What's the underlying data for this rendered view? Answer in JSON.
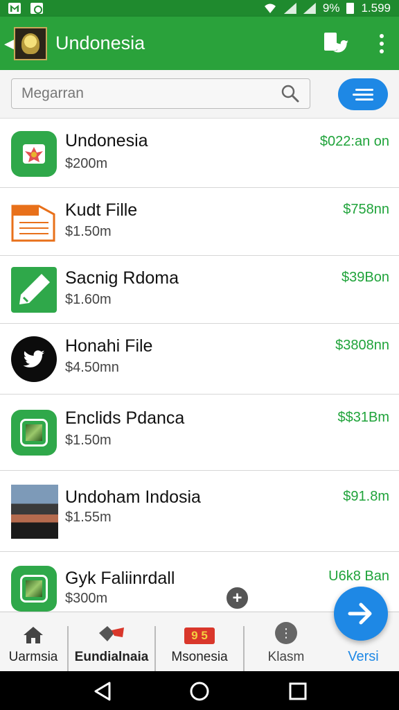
{
  "status_bar": {
    "battery": "9%",
    "time": "1.599"
  },
  "app_bar": {
    "title": "Undonesia",
    "back_icon": "back-arrow-icon",
    "logo_icon": "app-logo-icon",
    "action_icons": [
      "bird-page-icon",
      "more-vert-icon"
    ]
  },
  "search": {
    "placeholder": "Megarran",
    "icon": "search-icon",
    "filter_icon": "filter-lines-icon"
  },
  "items": [
    {
      "name": "Undonesia",
      "sub": "$200m",
      "price": "$022:an on",
      "icon": "emblem-icon"
    },
    {
      "name": "Kudt Fille",
      "sub": "$1.50m",
      "price": "$758nn",
      "icon": "document-icon"
    },
    {
      "name": "Sacnig Rdoma",
      "sub": "$1.60m",
      "price": "$39Bon",
      "icon": "pencil-icon"
    },
    {
      "name": "Honahi File",
      "sub": "$4.50mn",
      "price": "$3808nn",
      "icon": "twitter-bird-icon"
    },
    {
      "name": "Enclids Pdanca",
      "sub": "$1.50m",
      "price": "$$31Bm",
      "icon": "framed-picture-icon"
    },
    {
      "name": "Undoham Indosia",
      "sub": "$1.55m",
      "price": "$91.8m",
      "icon": "photo-thumbnail-icon"
    },
    {
      "name": "Gyk Faliinrdall",
      "sub": "$300m",
      "price": "U6k8 Ban",
      "icon": "framed-picture-icon"
    }
  ],
  "bottom_nav": {
    "tabs": [
      {
        "label": "Uarmsia",
        "icon": "home-icon"
      },
      {
        "label": "Eundialnaia",
        "icon": "tag-icon"
      },
      {
        "label": "Msonesia",
        "icon": "badge-icon",
        "badge": "9 5"
      },
      {
        "label": "Klasm",
        "icon": "info-circle-icon"
      },
      {
        "label": "Versi",
        "icon": "arrow-right-icon"
      }
    ]
  },
  "colors": {
    "primary": "#2aa23b",
    "status_bar": "#1f8a2e",
    "accent": "#1e88e5",
    "price": "#1fa33a"
  }
}
